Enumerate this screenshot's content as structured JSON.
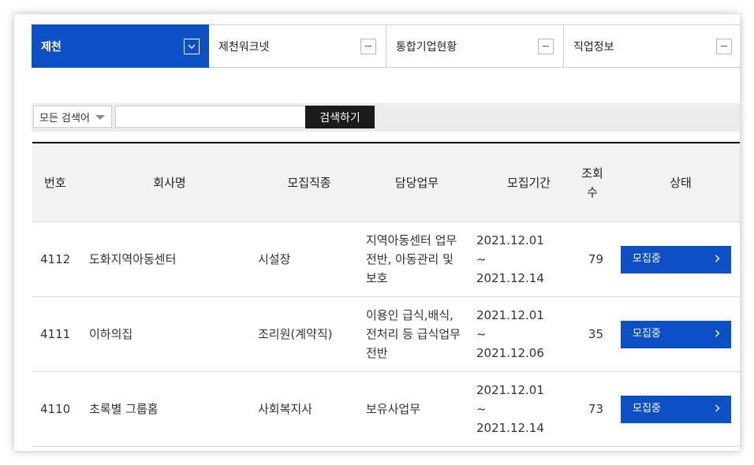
{
  "tabs": [
    {
      "label": "제천",
      "active": true,
      "icon": "chevron-down-icon"
    },
    {
      "label": "제천워크넷",
      "active": false,
      "icon": "minus-icon"
    },
    {
      "label": "통합기업현황",
      "active": false,
      "icon": "minus-icon"
    },
    {
      "label": "직업정보",
      "active": false,
      "icon": "minus-icon"
    }
  ],
  "search": {
    "select_value": "모든 검색어",
    "input_value": "",
    "input_placeholder": "",
    "button_label": "검색하기"
  },
  "table": {
    "headers": {
      "num": "번호",
      "company": "회사명",
      "job": "모집직종",
      "duty": "담당업무",
      "period": "모집기간",
      "views": "조회수",
      "status": "상태"
    },
    "rows": [
      {
        "num": "4112",
        "company": "도화지역아동센터",
        "job": "시설장",
        "duty": "지역아동센터 업무 전반, 아동관리 및 보호",
        "period_start": "2021.12.01",
        "period_sep": "~",
        "period_end": "2021.12.14",
        "views": "79",
        "status": "모집중"
      },
      {
        "num": "4111",
        "company": "이하의집",
        "job": "조리원(계약직)",
        "duty": "이용인 급식,배식, 전처리 등 급식업무 전반",
        "period_start": "2021.12.01",
        "period_sep": "~",
        "period_end": "2021.12.06",
        "views": "35",
        "status": "모집중"
      },
      {
        "num": "4110",
        "company": "초록별 그룹홈",
        "job": "사회복지사",
        "duty": "보유사업무",
        "period_start": "2021.12.01",
        "period_sep": "~",
        "period_end": "2021.12.14",
        "views": "73",
        "status": "모집중"
      }
    ]
  },
  "colors": {
    "accent": "#0d4fc5",
    "search_button": "#1b1b1b",
    "header_bg": "#f2f2f2"
  }
}
